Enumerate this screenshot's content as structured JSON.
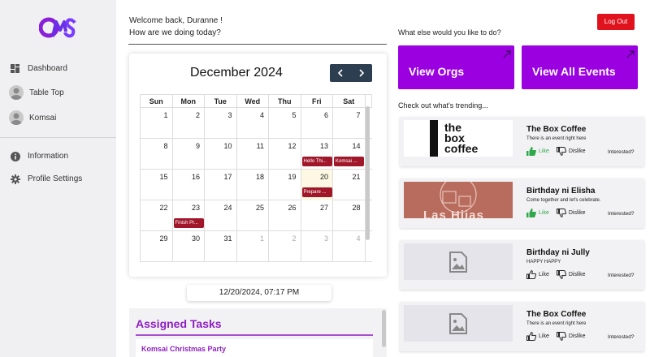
{
  "brand": {
    "accent": "#9b00e0",
    "logout_color": "#e0121d"
  },
  "sidebar": {
    "items": [
      {
        "label": "Dashboard",
        "icon": "dashboard-icon"
      },
      {
        "label": "Table Top",
        "icon": "avatar"
      },
      {
        "label": "Komsai",
        "icon": "avatar"
      },
      {
        "label": "Information",
        "icon": "info-icon"
      },
      {
        "label": "Profile Settings",
        "icon": "gear-icon"
      }
    ]
  },
  "header": {
    "welcome": "Welcome back, Duranne !",
    "subtitle": "How are we doing today?",
    "logout_label": "Log Out"
  },
  "calendar": {
    "title": "December 2024",
    "weekdays": [
      "Sun",
      "Mon",
      "Tue",
      "Wed",
      "Thu",
      "Fri",
      "Sat"
    ],
    "weeks": [
      [
        {
          "d": ""
        },
        {
          "d": "1"
        },
        {
          "d": "2"
        },
        {
          "d": "3"
        },
        {
          "d": "4"
        },
        {
          "d": "5"
        },
        {
          "d": "6"
        },
        {
          "d": "7"
        }
      ],
      [
        {
          "d": "8"
        },
        {
          "d": "9"
        },
        {
          "d": "10"
        },
        {
          "d": "11"
        },
        {
          "d": "12"
        },
        {
          "d": "13"
        },
        {
          "d": "14"
        }
      ],
      [
        {
          "d": "15"
        },
        {
          "d": "16"
        },
        {
          "d": "17"
        },
        {
          "d": "18"
        },
        {
          "d": "19"
        },
        {
          "d": "20"
        },
        {
          "d": "21"
        }
      ],
      [
        {
          "d": "22"
        },
        {
          "d": "23"
        },
        {
          "d": "24"
        },
        {
          "d": "25"
        },
        {
          "d": "26"
        },
        {
          "d": "27"
        },
        {
          "d": "28"
        }
      ],
      [
        {
          "d": "29"
        },
        {
          "d": "30"
        },
        {
          "d": "31"
        },
        {
          "d": "1"
        },
        {
          "d": "2"
        },
        {
          "d": "3"
        },
        {
          "d": "4"
        }
      ]
    ],
    "events": [
      {
        "day": "13",
        "label": "Hello Thi..."
      },
      {
        "day": "14",
        "label": "Komsai ..."
      },
      {
        "day": "20",
        "label": "Prepare ..."
      },
      {
        "day": "23",
        "label": "Finish Pr..."
      }
    ],
    "today": "20"
  },
  "datetime": "12/20/2024, 07:17 PM",
  "tasks": {
    "title": "Assigned Tasks",
    "items": [
      "Komsai Christmas Party"
    ]
  },
  "actions": {
    "prompt": "What else would you like to do?",
    "view_orgs": "View Orgs",
    "view_events": "View All Events"
  },
  "trending": {
    "heading": "Check out what's trending...",
    "like_label": "Like",
    "dislike_label": "Dislike",
    "interested_label": "Interested?",
    "events": [
      {
        "title": "The Box Coffee",
        "desc": "There is an event right here",
        "liked": true,
        "image": "box-coffee-logo",
        "logo_words": [
          "the",
          "box",
          "coffee"
        ]
      },
      {
        "title": "Birthday ni Elisha",
        "desc": "Come together and let's celebrate.",
        "liked": true,
        "image": "cafe-photo",
        "image_text": "Las Hijas"
      },
      {
        "title": "Birthday ni Jully",
        "desc": "HAPPY HAPPY",
        "liked": false,
        "image": "image-placeholder"
      },
      {
        "title": "The Box Coffee",
        "desc": "There is an event right here",
        "liked": false,
        "image": "image-placeholder"
      }
    ]
  }
}
